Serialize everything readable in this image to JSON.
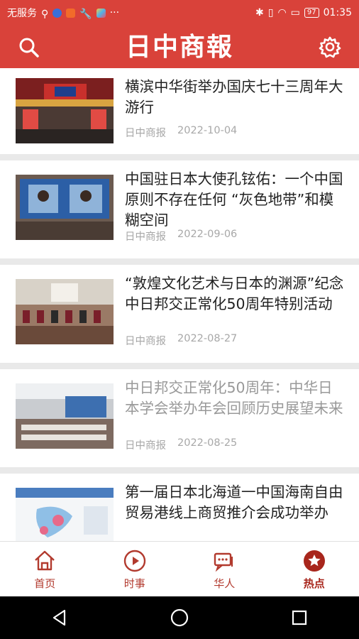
{
  "status_bar": {
    "carrier": "无服务",
    "battery": "97",
    "time": "01:35",
    "more": "···"
  },
  "header": {
    "logo_text": "日中商報",
    "search_icon": "search-icon",
    "settings_icon": "gear-icon"
  },
  "colors": {
    "brand": "#d9423a",
    "tab_accent": "#a8261c"
  },
  "articles": [
    {
      "title": "横滨中华街举办国庆七十三周年大游行",
      "source": "日中商报",
      "date": "2022-10-04",
      "read": false
    },
    {
      "title": "中国驻日本大使孔铉佑：一个中国原则不存在任何 “灰色地带”和模糊空间",
      "source": "日中商报",
      "date": "2022-09-06",
      "read": false
    },
    {
      "title": "“敦煌文化艺术与日本的渊源”纪念中日邦交正常化50周年特别活动",
      "source": "日中商报",
      "date": "2022-08-27",
      "read": false
    },
    {
      "title": "中日邦交正常化50周年：中华日本学会举办年会回顾历史展望未来",
      "source": "日中商报",
      "date": "2022-08-25",
      "read": true
    },
    {
      "title": "第一届日本北海道一中国海南自由贸易港线上商贸推介会成功举办",
      "source": "",
      "date": "",
      "read": false
    }
  ],
  "tabs": [
    {
      "label": "首页",
      "icon": "home-icon"
    },
    {
      "label": "时事",
      "icon": "play-circle-icon"
    },
    {
      "label": "华人",
      "icon": "chat-icon"
    },
    {
      "label": "热点",
      "icon": "star-badge-icon",
      "active": true
    }
  ],
  "nav": {
    "back_icon": "back-triangle-icon",
    "home_icon": "home-circle-icon",
    "recents_icon": "recents-square-icon"
  }
}
